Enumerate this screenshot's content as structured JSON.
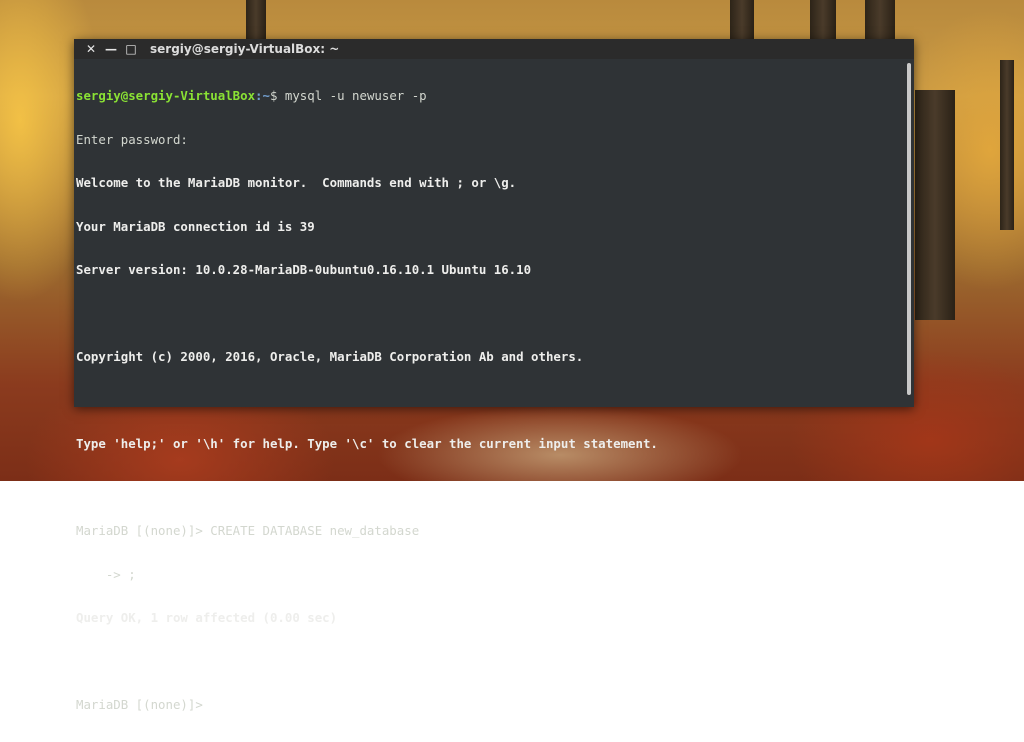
{
  "window": {
    "title": "sergiy@sergiy-VirtualBox: ~",
    "close_glyph": "✕",
    "minimize_glyph": "—",
    "maximize_glyph": "□"
  },
  "terminal": {
    "prompt_user": "sergiy@sergiy-VirtualBox",
    "prompt_path": ":~",
    "prompt_suffix": "$ ",
    "command": "mysql -u newuser -p",
    "lines": [
      "Enter password:",
      "Welcome to the MariaDB monitor.  Commands end with ; or \\g.",
      "Your MariaDB connection id is 39",
      "Server version: 10.0.28-MariaDB-0ubuntu0.16.10.1 Ubuntu 16.10",
      "",
      "Copyright (c) 2000, 2016, Oracle, MariaDB Corporation Ab and others.",
      "",
      "Type 'help;' or '\\h' for help. Type '\\c' to clear the current input statement.",
      "",
      "MariaDB [(none)]> CREATE DATABASE new_database",
      "    -> ;",
      "Query OK, 1 row affected (0.00 sec)",
      "",
      "MariaDB [(none)]> "
    ]
  },
  "colors": {
    "terminal_bg": "#2f3336",
    "prompt_user": "#8ae234",
    "prompt_path": "#729fcf"
  }
}
